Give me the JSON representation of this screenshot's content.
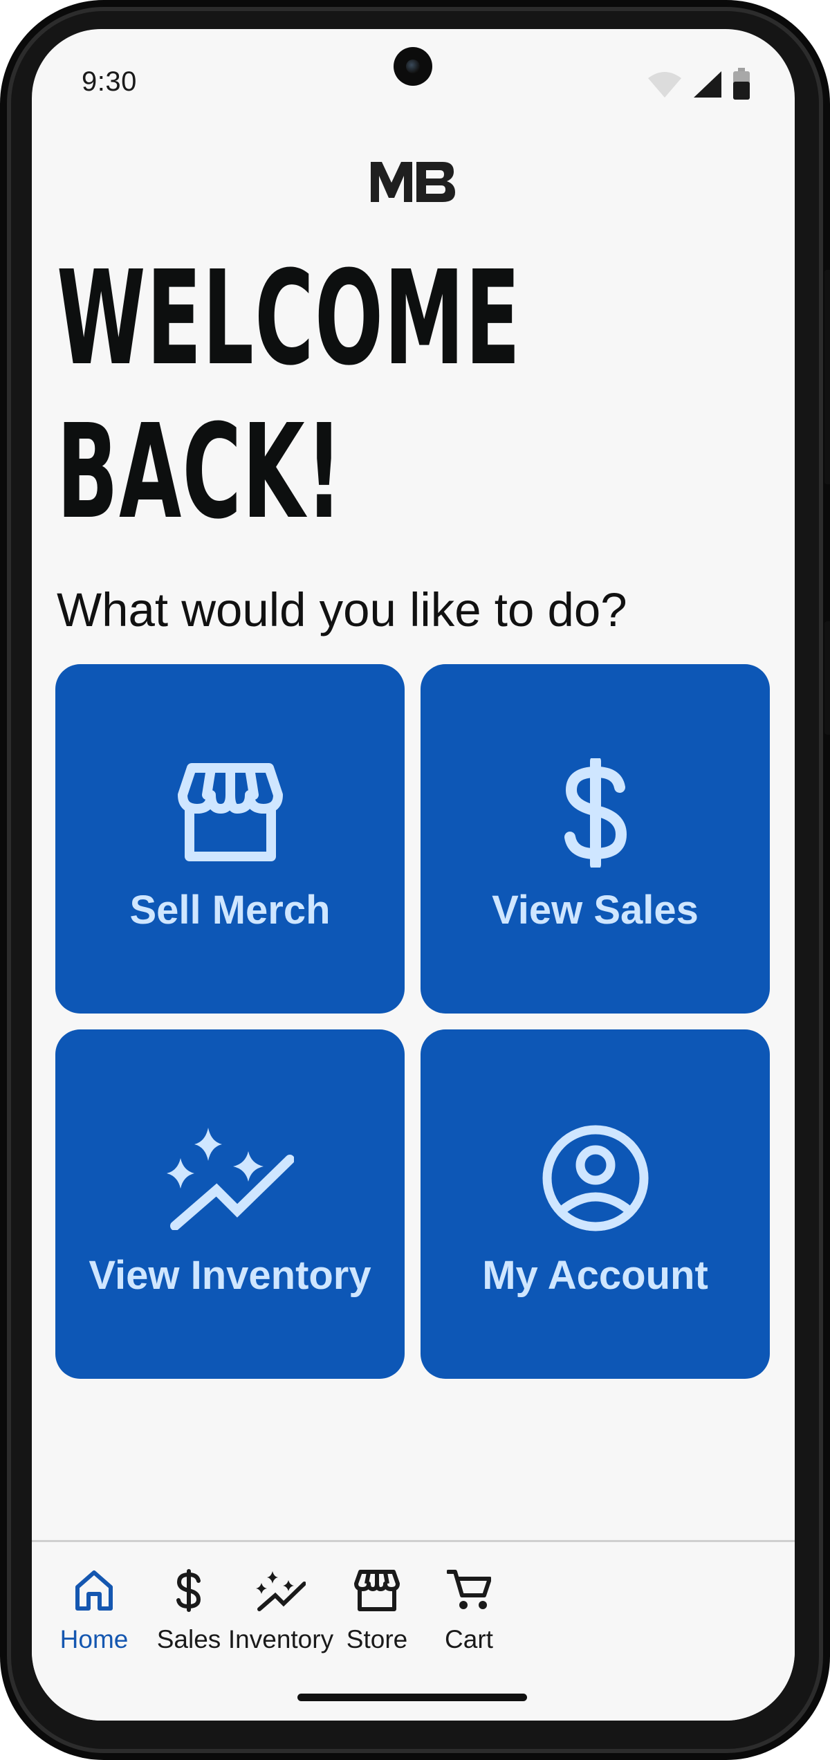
{
  "status_bar": {
    "time": "9:30",
    "icons": [
      "wifi-icon",
      "cellular-signal-icon",
      "battery-icon"
    ]
  },
  "header": {
    "logo_text": "MB"
  },
  "welcome": {
    "title": "WELCOME\nBACK!",
    "subtitle": "What would you like to do?"
  },
  "tiles": [
    {
      "label": "Sell Merch",
      "icon": "storefront-icon"
    },
    {
      "label": "View Sales",
      "icon": "dollar-icon"
    },
    {
      "label": "View Inventory",
      "icon": "sparkle-trend-icon"
    },
    {
      "label": "My Account",
      "icon": "account-circle-icon"
    }
  ],
  "bottom_nav": {
    "items": [
      {
        "label": "Home",
        "icon": "home-icon",
        "active": true
      },
      {
        "label": "Sales",
        "icon": "dollar-icon",
        "active": false
      },
      {
        "label": "Inventory",
        "icon": "sparkle-trend-icon",
        "active": false
      },
      {
        "label": "Store",
        "icon": "storefront-icon",
        "active": false
      },
      {
        "label": "Cart",
        "icon": "cart-icon",
        "active": false
      }
    ]
  },
  "colors": {
    "tile_background": "#0d57b6",
    "tile_foreground": "#cfe6ff",
    "nav_active": "#1557b0",
    "screen_background": "#f7f7f7"
  }
}
